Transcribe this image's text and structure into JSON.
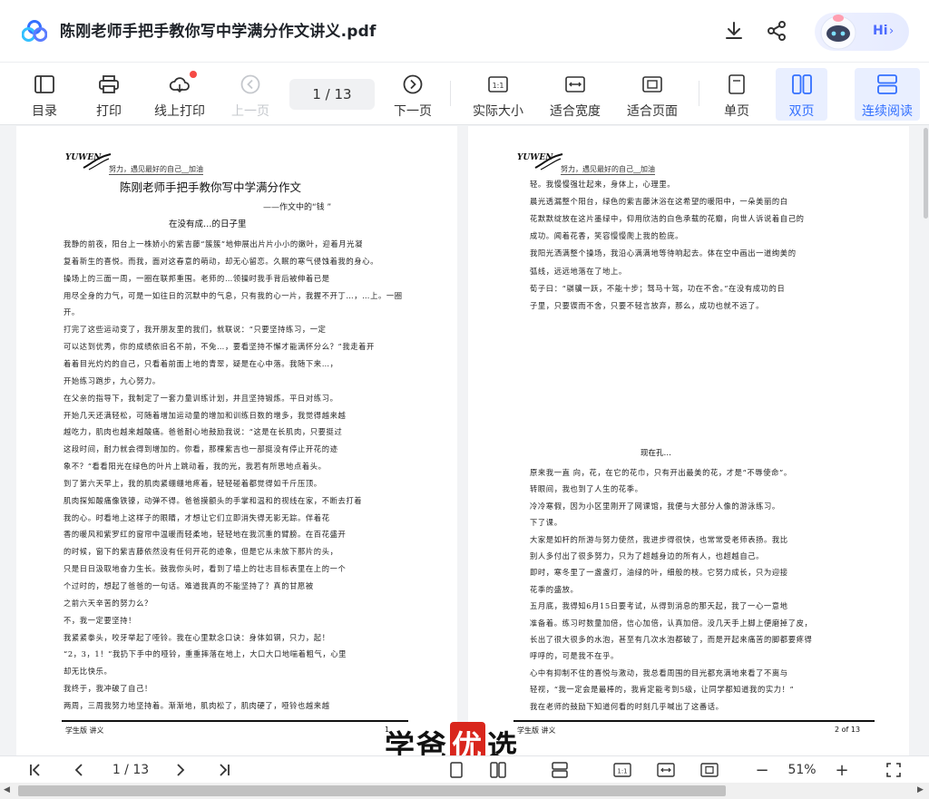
{
  "header": {
    "title": "陈刚老师手把手教你写中学满分作文讲义.pdf",
    "assistant_label": "Hi",
    "assistant_chevron": "›"
  },
  "toolbar": {
    "items": [
      {
        "label": "目录",
        "icon": "outline-icon"
      },
      {
        "label": "打印",
        "icon": "printer-icon"
      },
      {
        "label": "线上打印",
        "icon": "cloud-print-icon"
      },
      {
        "label": "上一页",
        "icon": "prev-page-icon"
      },
      {
        "label": "下一页",
        "icon": "next-page-icon"
      },
      {
        "label": "实际大小",
        "icon": "actual-size-icon"
      },
      {
        "label": "适合宽度",
        "icon": "fit-width-icon"
      },
      {
        "label": "适合页面",
        "icon": "fit-page-icon"
      },
      {
        "label": "单页",
        "icon": "single-page-icon"
      },
      {
        "label": "双页",
        "icon": "double-page-icon"
      },
      {
        "label": "连续阅读",
        "icon": "continuous-icon"
      }
    ],
    "page_indicator": "1  / 13"
  },
  "left_page": {
    "logo_text": "YUWEN",
    "motto": "努力，遇见最好的自己__加油",
    "title": "陈刚老师手把手教你写中学满分作文",
    "subtitle": "——作文中的“钱 ”",
    "section": "在没有成…的日子里",
    "lines": [
      "我静的前夜，阳台上一株娇小的紫吉藤“簇簇”地伸展出片片小小的嫩叶，迎着月光凝",
      "复着新生的喜悦。而我，面对这春意的萌动，却无心留恋。久眠的寒气侵蚀着我的身心。",
      "操场上的三面一周，一圈在联邦重围。老师的…领操时我手背后被伸着已是",
      "用尽全身的力气，可是一如往日的沉默中的气息，只有我的心一片，我握不开丁…，…上。一圈",
      "开。",
      "    打完了这些运动变了，我开朋友里的我们，就联说：“只要坚持练习，一定",
      "可以达到优秀，你的成绩依旧名不前，不免…，要看坚持不懈才能满怀分么？”我走着开",
      "着着目光灼灼的自己，只看着前面上地的青翠，疑是在心中落。我随下来…，",
      "开始练习跑步，九心努力。",
      "    在父亲的指导下，我制定了一套力量训练计划，并且坚持锻炼。平日对练习。",
      "开始几天还满轻松，可随着增加运动量的增加和训练日数的增多，我觉得越来越",
      "越吃力，肌肉也越来越酸痛。爸爸耐心地鼓励我说：“这是在长肌肉，只要挺过",
      "这段时间，耐力就会得到增加的。你看，那棵紫吉也一部挺没有停止开花的迹",
      "象不？”看看阳光在绿色的叶片上跳动着，我的光，我若有所思地点着头。",
      "    到了第六天早上，我的肌肉紧绷绷地疼着，轻轻碰着都觉得如千斤压顶。",
      "肌肉探知酸痛像铁镣，动弹不得。爸爸摸额头的手掌和温和的视线在家，不断去打着",
      "我的心。时看地上这样子的眼睛，才想让它们立即消失得无影无踪。伴着花",
      "香的暖风和紫罗红的窗帘中温暖而轻柔地，轻轻地在我沉重的臂膀。在百花盛开",
      "的时候，窗下的紫吉藤依然没有任何开花的迹象，但是它从未放下那片的头，",
      "只是日日汲取地奋力生长。鼓我你头时，看到了墙上的壮志目标表里在上的一个",
      "个过时的，想起了爸爸的一句话。难道我真的不能坚持了？真的甘愿被",
      "之前六天辛苦的努力么？",
      "    不，我一定要坚持！",
      "    我紧紧拳头，咬牙举起了哑铃。我在心里默念口诀：身体如钢，只力，起！",
      "“2，3，1！”我扔下手中的哑铃，重重摔落在地上，大口大口地喘着粗气，心里",
      "却无比快乐。",
      "    我终于，我冲破了自己！",
      "    两周，三周我努力地坚持着。渐渐地，肌肉松了，肌肉硬了，哑铃也越来越"
    ],
    "footer_left": "学生版    讲义",
    "footer_right": "1"
  },
  "right_page": {
    "logo_text": "YUWEN",
    "motto": "努力，遇见最好的自己__加油",
    "lines_top": [
      "轻。我慢慢强壮起来，身体上，心理里。",
      "    晨光透漏整个阳台，绿色的紫吉藤沐浴在这希望的暖阳中，一朵美丽的白",
      "花默默绽放在这片墨绿中，仰用欣洁的白色承载的花瓣，向世人诉说着自己的",
      "成功。闻着花香，笑容慢慢爬上我的脸庞。",
      "    我阳光洒满整个操场，我沿心满满地等待响起去。体在空中画出一道绚美的",
      "弧线，远远地落在了地上。",
      "    荀子曰：“骐骥一跃，不能十步；驽马十驾，功在不舍。”在没有成功的日",
      "子里，只要锲而不舍，只要不轻言放弃，那么，成功也就不远了。"
    ],
    "section": "现在孔…",
    "lines_bottom": [
      "    原来我一直 向，花，在它的花巾，只有开出最美的花，才是“不辱使命”。",
      "转眼间，我也到了人生的花季。",
      "    冷冷寒假，因为小区里刚开了网课馆，我便与大部分人像的游泳练习。",
      "下了课。",
      "    大家是如杆的所游与努力使然，我进步得很快，也常常受老师表扬。我比",
      "别人多付出了很多努力，只为了超越身边的所有人，也超越自己。",
      "    即时，寒冬里了一盏盏灯，油绿的叶，细般的枝。它努力成长，只为迎接",
      "花季的盛放。",
      "    五月底，我得知6月15日要考试，从得到消息的那天起，我了一心一意地",
      "准备着。练习时数量加倍，信心加倍，认真加倍。没几天手上脚上便磨掉了皮，",
      "长出了很大很多的水泡，甚至有几次水泡都破了，而是开起来痛苦的脚都要疼得",
      "呼呼的，可是我不在乎。",
      "    心中有抑制不住的喜悦与激动，我总看周围的目光都充满地来看了不离与",
      "轻视，“我一定会是最棒的，我肯定能考到5级，让同学都知道我的实力！”",
      "我在老师的鼓励下知道何看的时刻几乎喊出了这番话。"
    ],
    "footer_left": "学生版    讲义",
    "footer_right": "2 of 13"
  },
  "watermark": {
    "part1": "学爸",
    "part2": "优",
    "part3": "选"
  },
  "bottom": {
    "page_indicator": "1  / 13",
    "zoom": "51%",
    "zoom_minus": "−",
    "zoom_plus": "+"
  },
  "colors": {
    "accent": "#3370ff",
    "active_bg": "#e9efff",
    "badge_red": "#f54a45"
  }
}
